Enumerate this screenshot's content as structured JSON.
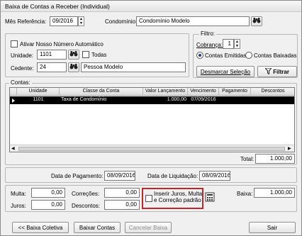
{
  "window": {
    "title": "Baixa de Contas a Receber (Individual)"
  },
  "header": {
    "mes_label": "Mês Referência:",
    "mes_value": "09/2016",
    "condominio_label": "Condomínio:",
    "condominio_value": "Condomínio Modelo"
  },
  "options": {
    "ativar_label": "Ativar Nosso Número Automático",
    "unidade_label": "Unidade:",
    "unidade_value": "1101",
    "todas_label": "Todas",
    "cedente_label": "Cedente:",
    "cedente_value": "24",
    "cedente_name": "Pessoa Modelo"
  },
  "filtro": {
    "title": "Filtro:",
    "cobranca_label": "Cobrança:",
    "cobranca_value": "1",
    "emitidas_label": "Contas Emitidas",
    "baixadas_label": "Contas Baixadas",
    "desmarcar_label": "Desmarcar Seleção",
    "filtrar_label": "Filtrar"
  },
  "contas": {
    "title": "Contas:",
    "columns": [
      "Unidade",
      "Classe da Conta",
      "Valor Lançamento",
      "Vencimento",
      "Pagamento",
      "Descontos"
    ],
    "rows": [
      {
        "unidade": "1101",
        "classe": "Taxa de Condomínio",
        "valor": "1.000,00",
        "vencimento": "07/09/2016",
        "pagamento": "",
        "descontos": ""
      }
    ],
    "total_label": "Total:",
    "total_value": "1.000,00"
  },
  "datas": {
    "pagamento_label": "Data de Pagamento:",
    "pagamento_value": "08/09/2016",
    "liquidacao_label": "Data de Liquidação:",
    "liquidacao_value": "08/09/2016"
  },
  "valores": {
    "multa_label": "Multa:",
    "multa_value": "0,00",
    "juros_label": "Juros:",
    "juros_value": "0,00",
    "correcoes_label": "Correções:",
    "correcoes_value": "0,00",
    "descontos_label": "Descontos:",
    "descontos_value": "0,00",
    "inserir_line1": "Inserir Juros, Multa",
    "inserir_line2": "e Correção padrão",
    "baixa_label": "Baixa:",
    "baixa_value": "1.000,00"
  },
  "footer": {
    "baixa_coletiva": "<< Baixa Coletiva",
    "baixar_contas": "Baixar Contas",
    "cancelar_baixa": "Cancelar Baixa",
    "sair": "Sair"
  },
  "colors": {
    "highlight": "#c0262c",
    "selected_row": "#000000"
  }
}
